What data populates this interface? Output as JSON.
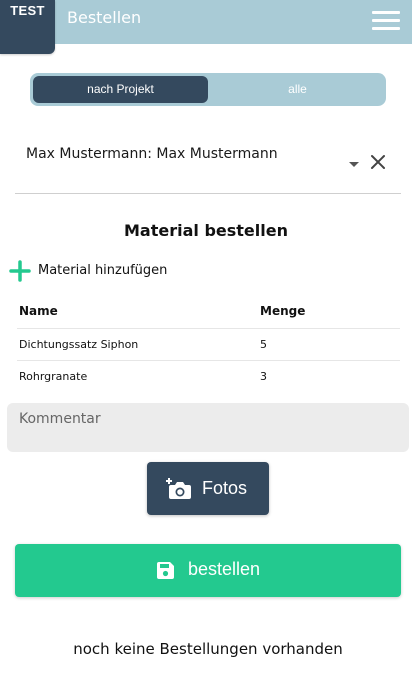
{
  "header": {
    "badge": "TEST",
    "title": "Bestellen",
    "menu_icon": "hamburger-menu-icon",
    "bg_color": "#a9cbd6",
    "badge_color": "#34495e"
  },
  "filter": {
    "options": [
      "nach Projekt",
      "alle"
    ],
    "selected": "nach Projekt"
  },
  "project": {
    "value": "Max Mustermann: Max Mustermann",
    "dropdown_icon": "caret-down-icon",
    "clear_icon": "close-icon"
  },
  "material": {
    "section_title": "Material bestellen",
    "add_label": "Material hinzufügen",
    "add_icon": "plus-icon",
    "accent_color": "#23c98f",
    "columns": [
      "Name",
      "Menge"
    ],
    "rows": [
      {
        "name": "Dichtungssatz Siphon",
        "qty": "5"
      },
      {
        "name": "Rohrgranate",
        "qty": "3"
      }
    ]
  },
  "comment": {
    "placeholder": "Kommentar"
  },
  "photos": {
    "label": "Fotos",
    "icon": "add-photo-camera-icon"
  },
  "order": {
    "label": "bestellen",
    "icon": "save-floppy-icon",
    "color": "#23c98f"
  },
  "empty_message": "noch keine Bestellungen vorhanden"
}
